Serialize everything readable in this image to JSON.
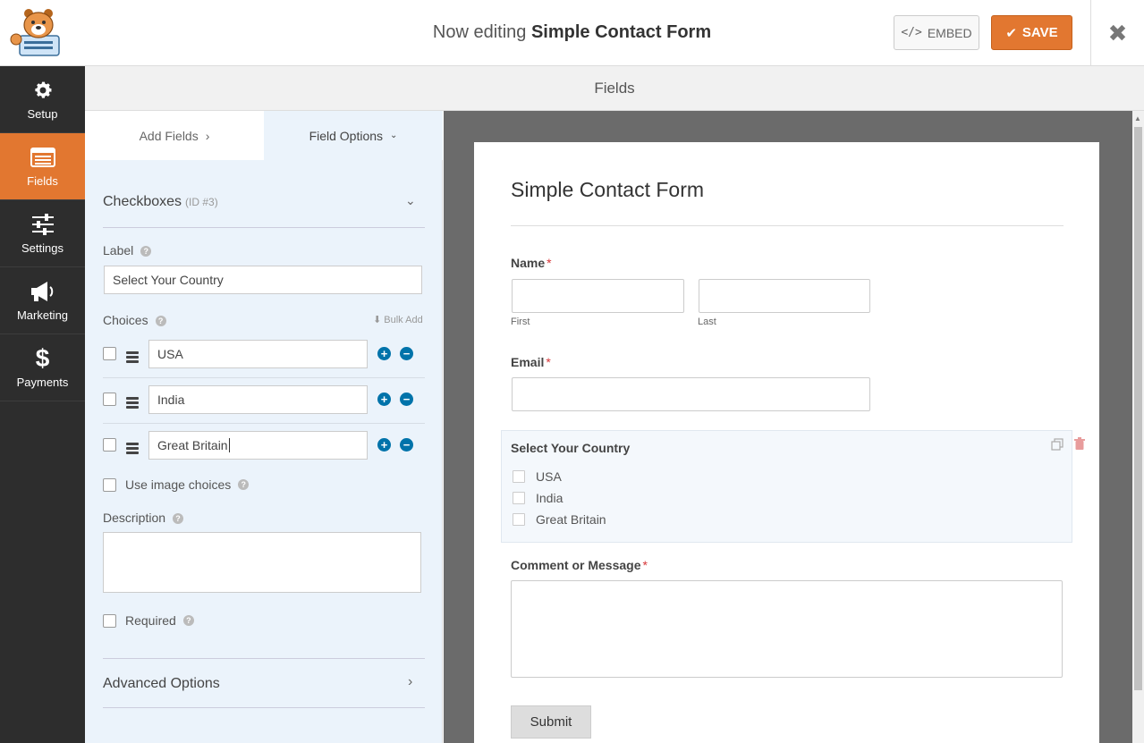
{
  "app": {
    "title_prefix": "Now editing",
    "form_name": "Simple Contact Form",
    "embed_label": "EMBED",
    "save_label": "SAVE",
    "close_symbol": "✖",
    "accent_color": "#e27730"
  },
  "sidebar": {
    "items": [
      {
        "label": "Setup",
        "icon": "gear-icon"
      },
      {
        "label": "Fields",
        "icon": "list-icon",
        "active": true
      },
      {
        "label": "Settings",
        "icon": "sliders-icon"
      },
      {
        "label": "Marketing",
        "icon": "megaphone-icon"
      },
      {
        "label": "Payments",
        "icon": "dollar-icon"
      }
    ]
  },
  "section": {
    "title": "Fields"
  },
  "panel": {
    "tab_add": "Add Fields",
    "tab_options": "Field Options",
    "field_type": "Checkboxes",
    "field_id": "(ID #3)",
    "label_title": "Label",
    "label_value": "Select Your Country",
    "choices_title": "Choices",
    "bulk_add": "Bulk Add",
    "choices": [
      "USA",
      "India",
      "Great Britain"
    ],
    "use_image_choices": "Use image choices",
    "description_title": "Description",
    "required_label": "Required",
    "advanced_options": "Advanced Options"
  },
  "preview": {
    "form_title": "Simple Contact Form",
    "name_label": "Name",
    "first_sub": "First",
    "last_sub": "Last",
    "email_label": "Email",
    "country_label": "Select Your Country",
    "country_options": [
      "USA",
      "India",
      "Great Britain"
    ],
    "comment_label": "Comment or Message",
    "required_mark": "*",
    "submit_label": "Submit"
  }
}
